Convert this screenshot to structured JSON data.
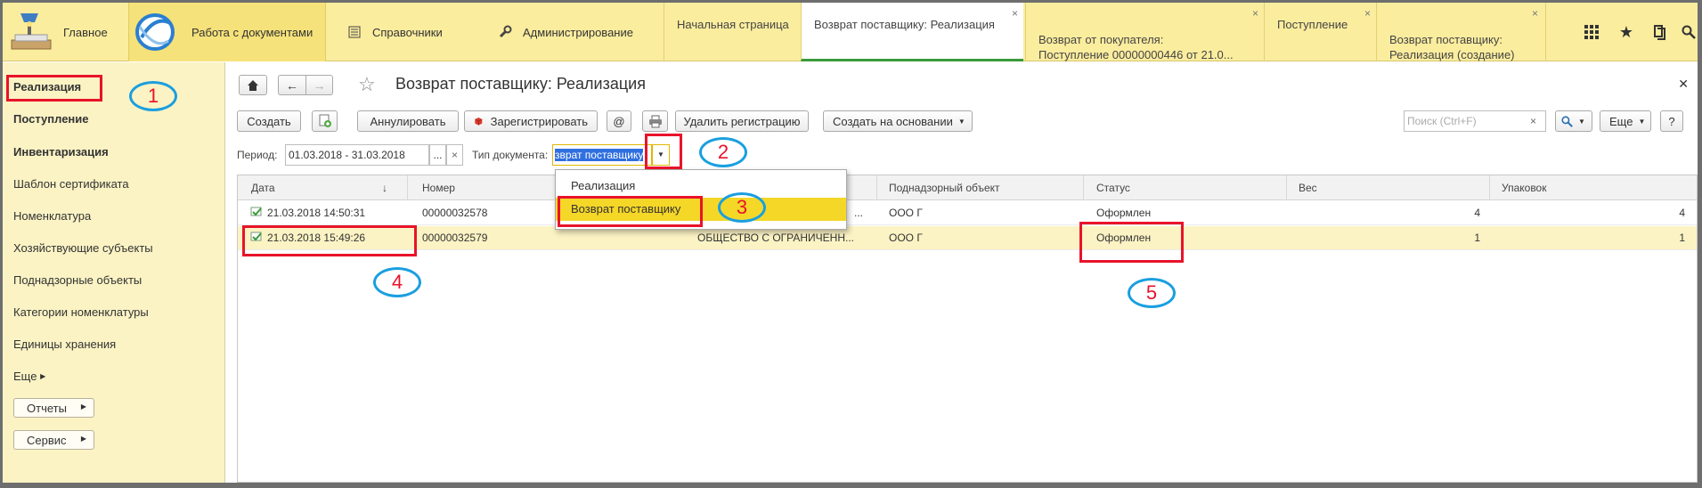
{
  "topbar": {
    "main_label": "Главное",
    "docs_label": "Работа с документами",
    "ref_label": "Справочники",
    "admin_label": "Администрирование",
    "tabs": [
      {
        "label": "Начальная страница"
      },
      {
        "label": "Возврат поставщику: Реализация",
        "closable": true
      },
      {
        "label": "Возврат от покупателя:\nПоступление 00000000446 от 21.0...",
        "closable": true
      },
      {
        "label": "Поступление",
        "closable": true
      },
      {
        "label": "Возврат поставщику:\nРеализация (создание)",
        "closable": true
      }
    ],
    "right_icons": [
      "apps-grid-icon",
      "star-icon",
      "history-icon",
      "search-icon"
    ]
  },
  "sidebar": {
    "items": [
      {
        "label": "Реализация",
        "bold": true
      },
      {
        "label": "Поступление",
        "bold": true
      },
      {
        "label": "Инвентаризация",
        "bold": true
      },
      {
        "label": "Шаблон сертификата"
      },
      {
        "label": "Номенклатура"
      },
      {
        "label": "Хозяйствующие субъекты"
      },
      {
        "label": "Поднадзорные объекты"
      },
      {
        "label": "Категории номенклатуры"
      },
      {
        "label": "Единицы хранения"
      }
    ],
    "more_label": "Еще",
    "reports_label": "Отчеты",
    "service_label": "Сервис"
  },
  "main": {
    "title": "Возврат поставщику: Реализация",
    "toolbar": {
      "create": "Создать",
      "cancel": "Аннулировать",
      "register": "Зарегистрировать",
      "at": "@",
      "delete_reg": "Удалить регистрацию",
      "create_based": "Создать на основании",
      "search_placeholder": "Поиск (Ctrl+F)",
      "more": "Еще",
      "help": "?"
    },
    "filter": {
      "period_label": "Период:",
      "period_value": "01.03.2018 - 31.03.2018",
      "period_dots": "...",
      "doc_type_label": "Тип документа:",
      "doc_type_value": "зврат поставщику"
    },
    "dropdown": {
      "options": [
        "Реализация",
        "Возврат поставщику"
      ],
      "highlighted": "Возврат поставщику"
    },
    "table": {
      "columns": [
        "Дата",
        "Номер",
        "Поднадзорный объект",
        "Статус",
        "Вес",
        "Упаковок"
      ],
      "rows": [
        {
          "date": "21.03.2018 14:50:31",
          "number": "00000032578",
          "org": "...",
          "object": "ООО Г",
          "status": "Оформлен",
          "weight": "4",
          "packs": "4"
        },
        {
          "date": "21.03.2018 15:49:26",
          "number": "00000032579",
          "org": "ОБЩЕСТВО С ОГРАНИЧЕНН...",
          "object": "ООО Г",
          "status": "Оформлен",
          "weight": "1",
          "packs": "1"
        }
      ]
    }
  },
  "annotations": [
    "1",
    "2",
    "3",
    "4",
    "5"
  ],
  "colors": {
    "topbar": "#fbed9e",
    "sidebar": "#fbf3c4",
    "highlight": "#f5d727",
    "annotation_red": "#e8132b",
    "annotation_blue": "#1a9fe0"
  }
}
